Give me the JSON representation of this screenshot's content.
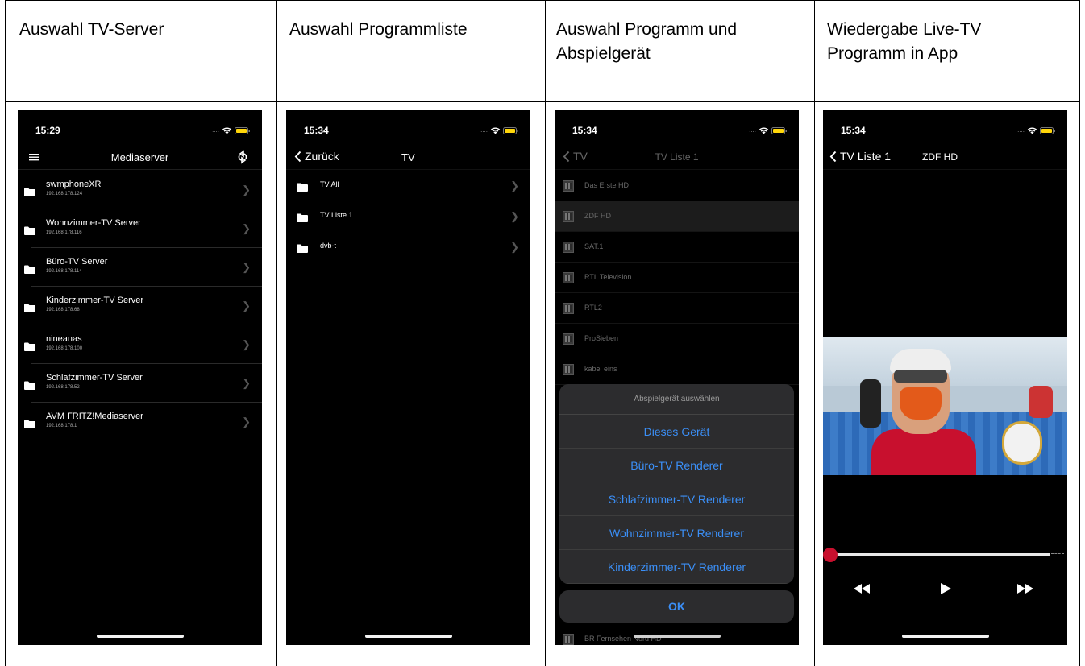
{
  "headers": [
    "Auswahl TV-Server",
    "Auswahl Programmliste",
    "Auswahl Programm und Abspielgerät",
    "Wiedergabe Live-TV Programm in App"
  ],
  "screen1": {
    "time": "15:29",
    "title": "Mediaserver",
    "servers": [
      {
        "name": "swmphoneXR",
        "ip": "192.168.178.124"
      },
      {
        "name": "Wohnzimmer-TV Server",
        "ip": "192.168.178.116"
      },
      {
        "name": "Büro-TV Server",
        "ip": "192.168.178.114"
      },
      {
        "name": "Kinderzimmer-TV Server",
        "ip": "192.168.178.68"
      },
      {
        "name": "nineanas",
        "ip": "192.168.178.100"
      },
      {
        "name": "Schlafzimmer-TV Server",
        "ip": "192.168.178.52"
      },
      {
        "name": "AVM FRITZ!Mediaserver",
        "ip": "192.168.178.1"
      }
    ]
  },
  "screen2": {
    "time": "15:34",
    "back": "Zurück",
    "title": "TV",
    "lists": [
      "TV All",
      "TV Liste 1",
      "dvb-t"
    ]
  },
  "screen3": {
    "time": "15:34",
    "back": "TV",
    "title": "TV Liste 1",
    "channels": [
      "Das Erste HD",
      "ZDF HD",
      "SAT.1",
      "RTL Television",
      "RTL2",
      "ProSieben",
      "kabel eins"
    ],
    "last_channel": "BR Fernsehen Nord HD",
    "sheet_title": "Abspielgerät auswählen",
    "devices": [
      "Dieses Gerät",
      "Büro-TV Renderer",
      "Schlafzimmer-TV Renderer",
      "Wohnzimmer-TV Renderer",
      "Kinderzimmer-TV Renderer"
    ],
    "ok": "OK"
  },
  "screen4": {
    "time": "15:34",
    "back": "TV Liste 1",
    "title": "ZDF HD",
    "progress": 0.0
  },
  "colors": {
    "accent": "#3b8ff7",
    "battery": "#ffd60a",
    "scrubber": "#c8102e"
  },
  "icons": [
    "menu-icon",
    "refresh-icon",
    "folder-icon",
    "chevron-right-icon",
    "back-chevron-icon",
    "wifi-icon",
    "battery-icon",
    "rewind-icon",
    "play-icon",
    "fast-forward-icon"
  ]
}
